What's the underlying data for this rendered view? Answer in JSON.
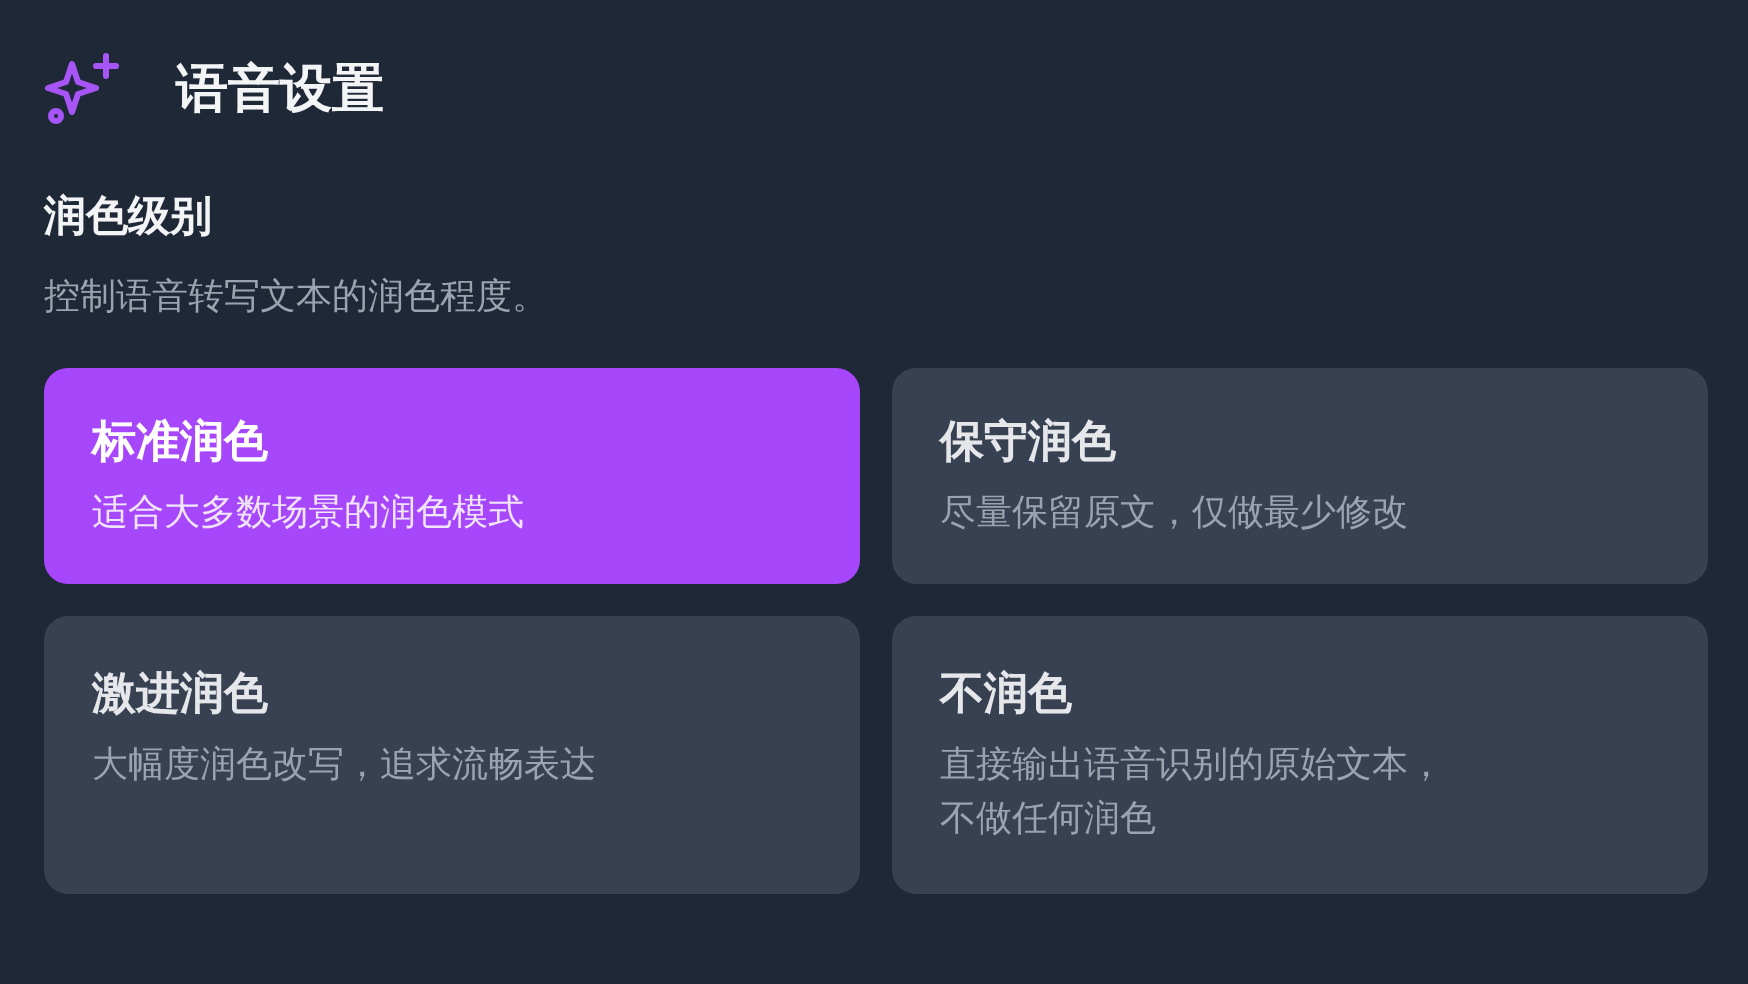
{
  "header": {
    "title": "语音设置"
  },
  "section": {
    "title": "润色级别",
    "description": "控制语音转写文本的润色程度。"
  },
  "options": [
    {
      "title": "标准润色",
      "description": "适合大多数场景的润色模式",
      "selected": true
    },
    {
      "title": "保守润色",
      "description": "尽量保留原文，仅做最少修改",
      "selected": false
    },
    {
      "title": "激进润色",
      "description": "大幅度润色改写，追求流畅表达",
      "selected": false
    },
    {
      "title": "不润色",
      "description": "直接输出语音识别的原始文本，不做任何润色",
      "selected": false
    }
  ]
}
